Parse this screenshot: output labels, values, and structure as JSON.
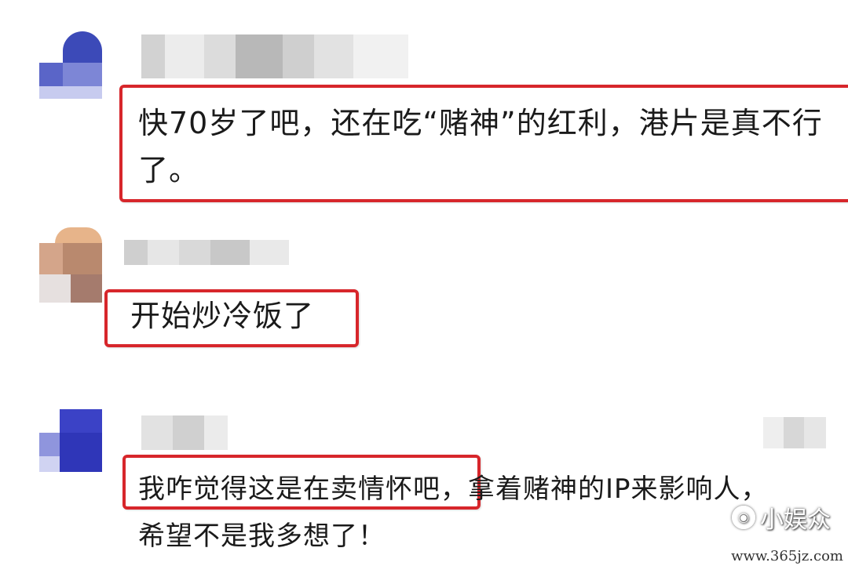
{
  "comments": [
    {
      "id": 1,
      "text_line1": "快70岁了吧，还在吃“赌神”的红利，港片是真不行",
      "text_line2": "了。"
    },
    {
      "id": 2,
      "text_line1": "开始炒冷饭了"
    },
    {
      "id": 3,
      "text_line1": "我咋觉得这是在卖情怀吧，拿着赌神的IP来影响人，",
      "text_line2": "希望不是我多想了！"
    }
  ],
  "watermark": {
    "brand": "小娱众",
    "url": "www.365jz.com"
  },
  "colors": {
    "highlight_border": "#d7262b",
    "background": "#ffffff"
  }
}
